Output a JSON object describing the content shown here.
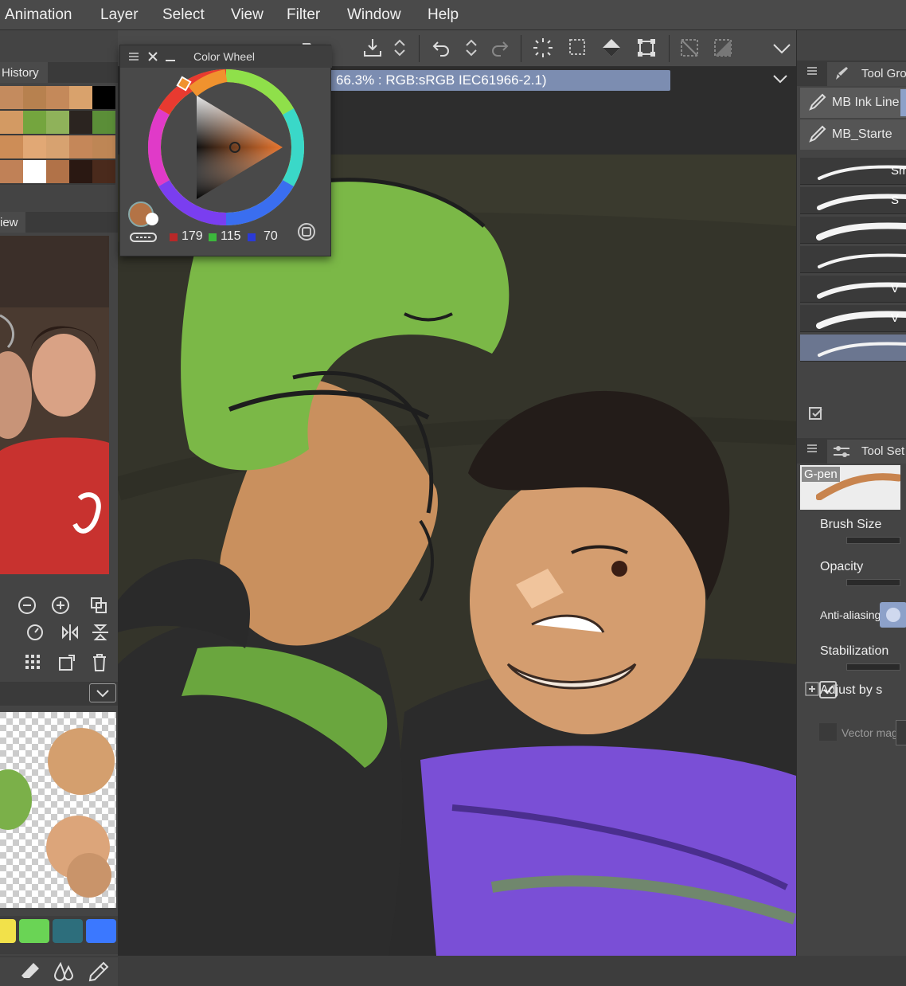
{
  "menubar": {
    "items": [
      "Animation",
      "Layer",
      "Select",
      "View",
      "Filter",
      "Window",
      "Help"
    ]
  },
  "status_bar": {
    "text": "66.3% : RGB:sRGB IEC61966-2.1)"
  },
  "color_wheel": {
    "title": "Color Wheel",
    "r": "179",
    "g": "115",
    "b": "70",
    "current_color": "#b37346"
  },
  "left_panel": {
    "history_tab": "History",
    "view_tab": "iew",
    "palette": [
      "#c48b5e",
      "#b7814f",
      "#c4895a",
      "#d9a26c",
      "#000000",
      "#d39a63",
      "#74a53e",
      "#8fb25a",
      "#2b2420",
      "#5b8e38",
      "#cd8d57",
      "#e1a875",
      "#d7a270",
      "#c58759",
      "#be8655",
      "#c08157",
      "#ffffff",
      "#b17248",
      "#2a1812",
      "#4a2a1c"
    ],
    "swatches": [
      "#f2e14a",
      "#6ad455",
      "#2d6e7c",
      "#3b78ff"
    ]
  },
  "right_panel": {
    "tool_group_tab": "Tool Gro",
    "tool_set_tab": "Tool Set",
    "brushes": [
      "MB Ink Line",
      "MB_Starte"
    ],
    "brush_strokes": [
      "Sm",
      "S",
      "",
      "",
      "V",
      "V",
      ""
    ],
    "gpen_label": "G-pen",
    "brush_size_label": "Brush Size",
    "opacity_label": "Opacity",
    "anti_aliasing_label": "Anti-aliasing",
    "stabilization_label": "Stabilization",
    "adjust_label": "Adjust by s",
    "vector_label": "Vector mag"
  },
  "colors": {
    "ui_bg": "#444444",
    "menubar_bg": "#4a4a4a",
    "canvas_bg": "#3a3a2e",
    "accent_blue": "#8da1c9"
  }
}
